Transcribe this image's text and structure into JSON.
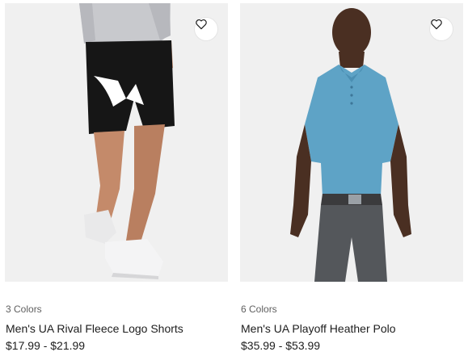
{
  "products": [
    {
      "colors": "3 Colors",
      "name": "Men's UA Rival Fleece Logo Shorts",
      "price": "$17.99 - $21.99",
      "image": "model-wearing-black-shorts-image"
    },
    {
      "colors": "6 Colors",
      "name": "Men's UA Playoff Heather Polo",
      "price": "$35.99 - $53.99",
      "image": "model-wearing-blue-polo-image"
    }
  ],
  "icons": {
    "wishlist": "heart-icon"
  },
  "colors": {
    "background": "#ffffff",
    "image_bg": "#f0f0f0",
    "text": "#1d1d1d",
    "muted": "#5f5f5f",
    "shorts": "#161616",
    "polo": "#5ea3c6",
    "pants": "#54575b"
  }
}
